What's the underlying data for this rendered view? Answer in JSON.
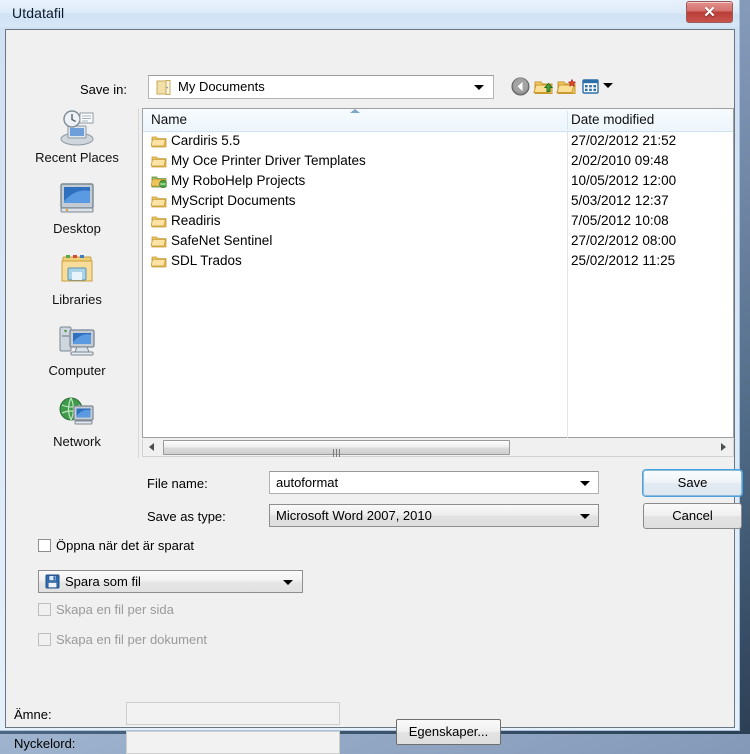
{
  "window": {
    "title": "Utdatafil",
    "close_label": "✕"
  },
  "filedialog": {
    "save_in_label": "Save in:",
    "save_in_value": "My Documents",
    "toolbar": {
      "back": "back-icon",
      "up": "up-one-level-icon",
      "new_folder": "new-folder-icon",
      "views": "views-icon"
    },
    "places": [
      {
        "label": "Recent Places",
        "icon": "recent-places-icon"
      },
      {
        "label": "Desktop",
        "icon": "desktop-icon"
      },
      {
        "label": "Libraries",
        "icon": "libraries-icon"
      },
      {
        "label": "Computer",
        "icon": "computer-icon"
      },
      {
        "label": "Network",
        "icon": "network-icon"
      }
    ],
    "columns": [
      "Name",
      "Date modified"
    ],
    "sort": "ascending",
    "files": [
      {
        "name": "Cardiris 5.5",
        "date": "27/02/2012 21:52",
        "icon": "folder-icon"
      },
      {
        "name": "My Oce Printer Driver Templates",
        "date": "2/02/2010 09:48",
        "icon": "folder-icon"
      },
      {
        "name": "My RoboHelp Projects",
        "date": "10/05/2012 12:00",
        "icon": "folder-shared-icon"
      },
      {
        "name": "MyScript Documents",
        "date": "5/03/2012 12:37",
        "icon": "folder-icon"
      },
      {
        "name": "Readiris",
        "date": "7/05/2012 10:08",
        "icon": "folder-icon"
      },
      {
        "name": "SafeNet Sentinel",
        "date": "27/02/2012 08:00",
        "icon": "folder-icon"
      },
      {
        "name": "SDL Trados",
        "date": "25/02/2012 11:25",
        "icon": "folder-icon"
      }
    ],
    "file_name_label": "File name:",
    "file_name_value": "autoformat",
    "save_as_type_label": "Save as type:",
    "save_as_type_value": "Microsoft Word 2007, 2010",
    "save_button": "Save",
    "cancel_button": "Cancel"
  },
  "options": {
    "open_when_saved": {
      "label": "Öppna när det är sparat",
      "checked": false,
      "enabled": true
    },
    "save_mode": {
      "value": "Spara som fil",
      "icon": "floppy-disk-icon"
    },
    "file_per_page": {
      "label": "Skapa en fil per sida",
      "checked": false,
      "enabled": false
    },
    "file_per_document": {
      "label": "Skapa en fil per dokument",
      "checked": false,
      "enabled": false
    }
  },
  "metadata": {
    "subject_label": "Ämne:",
    "subject_value": "",
    "keywords_label": "Nyckelord:",
    "keywords_value": "",
    "properties_button": "Egenskaper..."
  },
  "colors": {
    "accent_blue": "#4aa3e0",
    "close_red": "#b93e38",
    "folder_yellow": "#f5c961",
    "dialog_gray": "#f0f0f0"
  }
}
